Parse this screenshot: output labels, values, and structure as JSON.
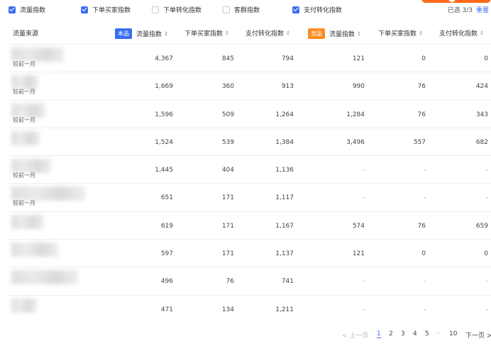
{
  "filters": [
    {
      "label": "流量指数",
      "checked": true
    },
    {
      "label": "下单买家指数",
      "checked": true
    },
    {
      "label": "下单转化指数",
      "checked": false
    },
    {
      "label": "客群指数",
      "checked": false
    },
    {
      "label": "支付转化指数",
      "checked": true
    }
  ],
  "selection": {
    "info": "已选 3/3",
    "reset": "重置"
  },
  "table": {
    "source_header": "流量来源",
    "self_tag": "本品",
    "competitor_tag": "竞品",
    "columns": [
      "流量指数",
      "下单买家指数",
      "支付转化指数",
      "流量指数",
      "下单买家指数",
      "支付转化指数"
    ],
    "compare_label": "较前一月",
    "rows": [
      {
        "cells": [
          "4,367",
          "845",
          "794",
          "121",
          "0",
          "0"
        ]
      },
      {
        "cells": [
          "1,669",
          "360",
          "913",
          "990",
          "76",
          "424"
        ]
      },
      {
        "cells": [
          "1,596",
          "509",
          "1,264",
          "1,284",
          "76",
          "343"
        ]
      },
      {
        "cells": [
          "1,524",
          "539",
          "1,384",
          "3,496",
          "557",
          "682"
        ]
      },
      {
        "cells": [
          "1,445",
          "404",
          "1,136",
          "-",
          "-",
          "-"
        ]
      },
      {
        "cells": [
          "651",
          "171",
          "1,117",
          "-",
          "-",
          "-"
        ]
      },
      {
        "cells": [
          "619",
          "171",
          "1,167",
          "574",
          "76",
          "659"
        ]
      },
      {
        "cells": [
          "597",
          "171",
          "1,137",
          "121",
          "0",
          "0"
        ]
      },
      {
        "cells": [
          "496",
          "76",
          "741",
          "-",
          "-",
          "-"
        ]
      },
      {
        "cells": [
          "471",
          "134",
          "1,211",
          "-",
          "-",
          "-"
        ]
      }
    ]
  },
  "pagination": {
    "prev": "< 上一页",
    "pages": [
      "1",
      "2",
      "3",
      "4",
      "5"
    ],
    "ellipsis": "···",
    "last": "10",
    "next": "下一页 >",
    "current": "1"
  }
}
